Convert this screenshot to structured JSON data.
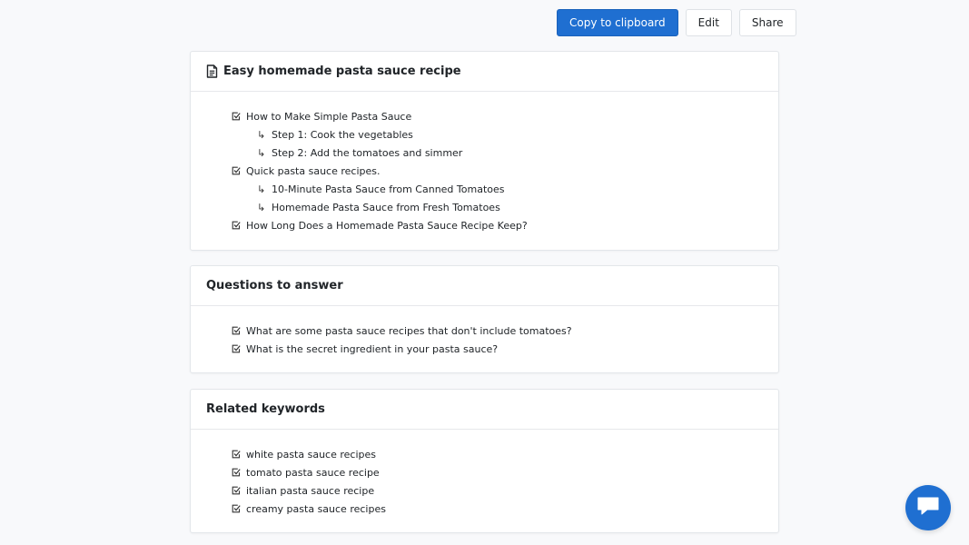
{
  "toolbar": {
    "copy_label": "Copy to clipboard",
    "edit_label": "Edit",
    "share_label": "Share"
  },
  "outline": {
    "title": "Easy homemade pasta sauce recipe",
    "items": [
      {
        "label": "How to Make Simple Pasta Sauce",
        "children": [
          "Step 1: Cook the vegetables",
          "Step 2: Add the tomatoes and simmer"
        ]
      },
      {
        "label": "Quick pasta sauce recipes.",
        "children": [
          "10-Minute Pasta Sauce from Canned Tomatoes",
          "Homemade Pasta Sauce from Fresh Tomatoes"
        ]
      },
      {
        "label": "How Long Does a Homemade Pasta Sauce Recipe Keep?",
        "children": []
      }
    ]
  },
  "questions": {
    "title": "Questions to answer",
    "items": [
      "What are some pasta sauce recipes that don't include tomatoes?",
      "What is the secret ingredient in your pasta sauce?"
    ]
  },
  "keywords": {
    "title": "Related keywords",
    "items": [
      "white pasta sauce recipes",
      "tomato pasta sauce recipe",
      "italian pasta sauce recipe",
      "creamy pasta sauce recipes"
    ]
  },
  "icons": {
    "title_icon": "document-icon",
    "item_icon": "checkbox-checked-icon",
    "sub_icon": "subitem-arrow-icon",
    "chat_icon": "chat-bubble-icon"
  },
  "colors": {
    "primary": "#1f6fd1",
    "background": "#f8f9fb"
  }
}
